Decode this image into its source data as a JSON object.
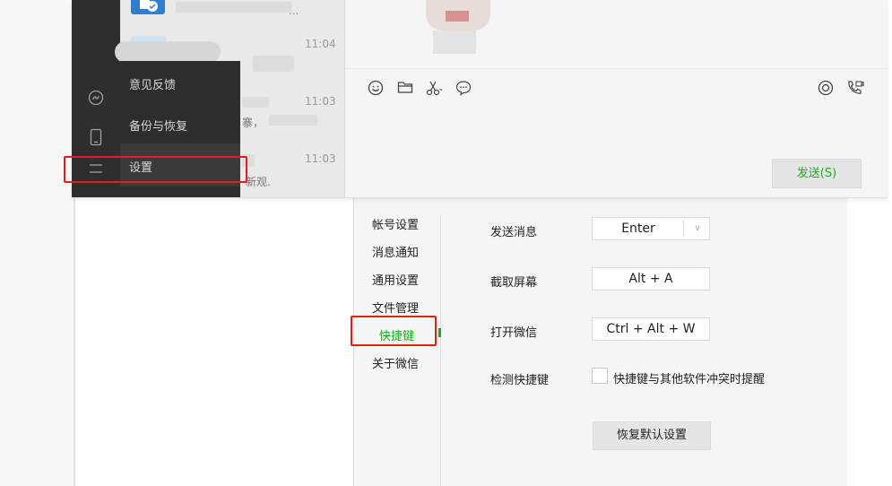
{
  "wechat": {
    "chat_list": {
      "times": [
        "11:04",
        "11:03",
        "11:03"
      ],
      "snippet_fragments": [
        "...",
        "寨，",
        "新观."
      ]
    },
    "popup_menu": {
      "items": [
        "意见反馈",
        "备份与恢复",
        "设置"
      ],
      "highlighted": "设置"
    },
    "toolbar_icons": [
      "emoji-icon",
      "folder-icon",
      "scissors-icon",
      "chat-bubble-icon"
    ],
    "right_icons": [
      "live-icon",
      "call-icon"
    ],
    "send_button": "发送(S)"
  },
  "settings": {
    "menu": [
      "帐号设置",
      "消息通知",
      "通用设置",
      "文件管理",
      "快捷键",
      "关于微信"
    ],
    "active_menu": "快捷键",
    "shortcuts": [
      {
        "label": "发送消息",
        "value": "Enter"
      },
      {
        "label": "截取屏幕",
        "value": "Alt + A"
      },
      {
        "label": "打开微信",
        "value": "Ctrl + Alt + W"
      }
    ],
    "detect_label": "检测快捷键",
    "detect_checkbox_text": "快捷键与其他软件冲突时提醒",
    "detect_checked": false,
    "restore_button": "恢复默认设置"
  },
  "colors": {
    "accent_green": "#1aad19",
    "highlight_red": "#e21d1d",
    "sidebar_dark": "#2e2e2e"
  }
}
